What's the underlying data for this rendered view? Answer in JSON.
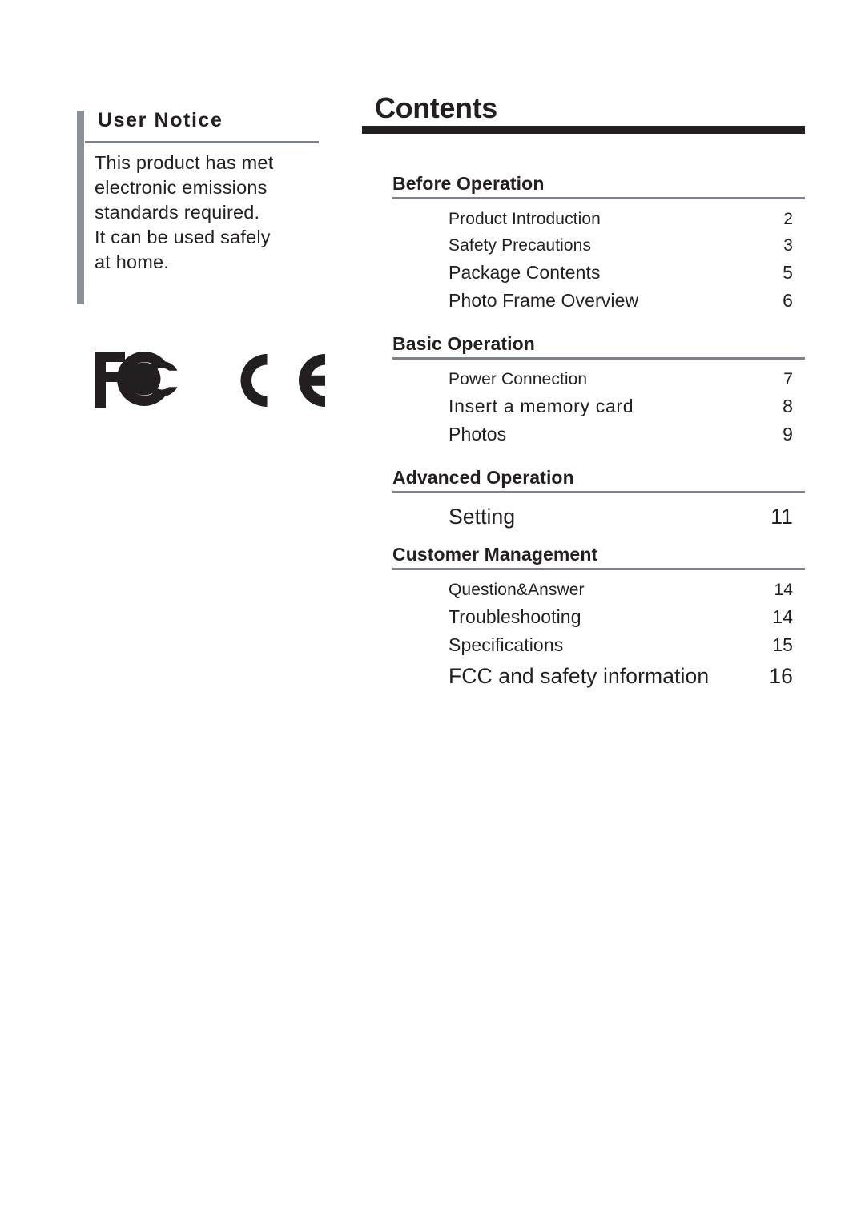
{
  "notice": {
    "heading": "User Notice",
    "lines": [
      "This product has met",
      "electronic emissions",
      "standards required.",
      "It can be used safely",
      "at home."
    ]
  },
  "logos": [
    {
      "name": "fcc-logo",
      "label": "FCC"
    },
    {
      "name": "ce-logo",
      "label": "CE"
    }
  ],
  "contents": {
    "title": "Contents",
    "sections": [
      {
        "title": "Before Operation",
        "entries": [
          {
            "label": "Product Introduction",
            "page": "2"
          },
          {
            "label": "Safety Precautions",
            "page": "3"
          },
          {
            "label": "Package Contents",
            "page": "5"
          },
          {
            "label": "Photo Frame Overview",
            "page": "6"
          }
        ]
      },
      {
        "title": "Basic Operation",
        "entries": [
          {
            "label": "Power Connection",
            "page": "7"
          },
          {
            "label": "Insert a memory card",
            "page": "8"
          },
          {
            "label": "Photos",
            "page": "9"
          }
        ]
      },
      {
        "title": "Advanced Operation",
        "entries": [
          {
            "label": "Setting",
            "page": "11"
          }
        ]
      },
      {
        "title": "Customer Management",
        "entries": [
          {
            "label": "Question&Answer",
            "page": "14"
          },
          {
            "label": "Troubleshooting",
            "page": "14"
          },
          {
            "label": "Specifications",
            "page": "15"
          },
          {
            "label": "FCC and safety information",
            "page": "16"
          }
        ]
      }
    ]
  },
  "colors": {
    "accent_bar": "#8c9199",
    "title_bar": "#231f1f",
    "rule": "#7d828a",
    "text": "#231f20"
  }
}
